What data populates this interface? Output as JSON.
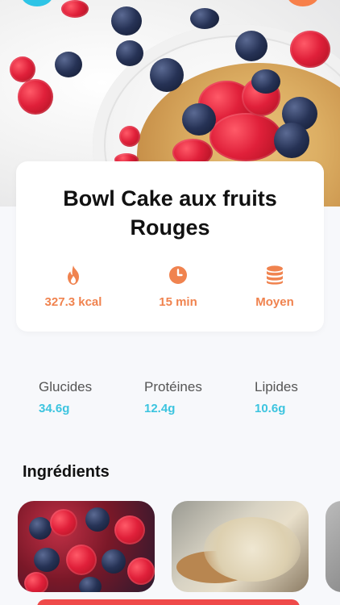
{
  "recipe": {
    "title": "Bowl Cake aux fruits Rouges"
  },
  "stats": [
    {
      "icon": "flame-icon",
      "value": "327.3 kcal"
    },
    {
      "icon": "clock-icon",
      "value": "15 min"
    },
    {
      "icon": "coins-icon",
      "value": "Moyen"
    }
  ],
  "macros": [
    {
      "label": "Glucides",
      "value": "34.6g"
    },
    {
      "label": "Protéines",
      "value": "12.4g"
    },
    {
      "label": "Lipides",
      "value": "10.6g"
    }
  ],
  "ingredients": {
    "title": "Ingrédients"
  },
  "colors": {
    "accent_orange": "#f0834f",
    "accent_teal": "#3cc4df",
    "action_red": "#ef4a4a"
  }
}
